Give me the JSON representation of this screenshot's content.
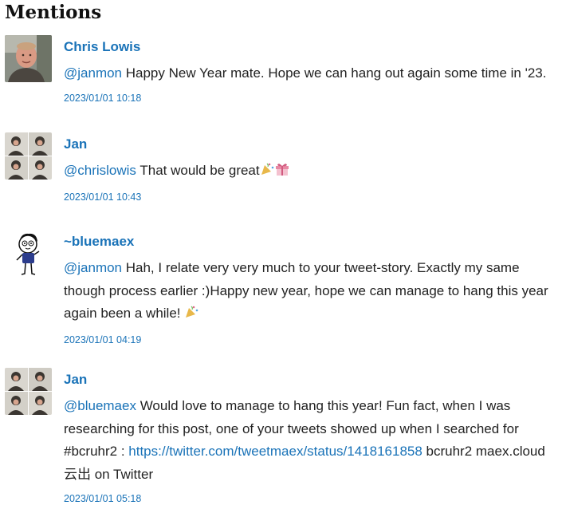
{
  "heading": "Mentions",
  "mentions": [
    {
      "author": "Chris Lowis",
      "handle": "@janmon",
      "text": " Happy New Year mate. Hope we can hang out again some time in '23.",
      "date": "2023/01/01 10:18",
      "avatar_icon": "portrait-photo"
    },
    {
      "author": "Jan",
      "handle": "@chrislowis",
      "text": " That would be great",
      "emoji": [
        "party-popper-icon",
        "gift-icon"
      ],
      "date": "2023/01/01 10:43",
      "avatar_icon": "photo-grid-portrait"
    },
    {
      "author": "~bluemaex",
      "handle": "@janmon",
      "text": " Hah, I relate very very much to your tweet-story. Exactly my same though process earlier :)Happy new year, hope we can manage to hang this year again been a while! ",
      "emoji": [
        "party-popper-icon"
      ],
      "date": "2023/01/01 04:19",
      "avatar_icon": "cartoon-character"
    },
    {
      "author": "Jan",
      "handle": "@bluemaex",
      "text": " Would love to manage to hang this year! Fun fact, when I was researching for this post, one of your tweets showed up when I searched for #bcruhr2 : ",
      "link": "https://twitter.com/tweetmaex/status/1418161858",
      "text_after": " bcruhr2 maex.cloud 云出 on Twitter",
      "date": "2023/01/01 05:18",
      "avatar_icon": "photo-grid-portrait"
    }
  ],
  "colors": {
    "link": "#1a73b8",
    "text": "#222222"
  }
}
